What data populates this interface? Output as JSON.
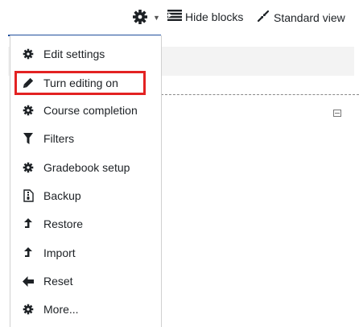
{
  "topbar": {
    "hide_blocks": "Hide blocks",
    "standard_view": "Standard view"
  },
  "menu": {
    "items": [
      {
        "label": "Edit settings",
        "icon": "gear-icon"
      },
      {
        "label": "Turn editing on",
        "icon": "pencil-icon"
      },
      {
        "label": "Course completion",
        "icon": "gear-icon"
      },
      {
        "label": "Filters",
        "icon": "filter-icon"
      },
      {
        "label": "Gradebook setup",
        "icon": "gear-icon"
      },
      {
        "label": "Backup",
        "icon": "file-archive-icon"
      },
      {
        "label": "Restore",
        "icon": "upload-arrow-icon"
      },
      {
        "label": "Import",
        "icon": "upload-arrow-icon"
      },
      {
        "label": "Reset",
        "icon": "arrow-left-icon"
      },
      {
        "label": "More...",
        "icon": "gear-icon"
      }
    ],
    "highlighted_item": "Turn editing on"
  },
  "colors": {
    "highlight": "#e32222",
    "accent": "#1f4e9c"
  }
}
